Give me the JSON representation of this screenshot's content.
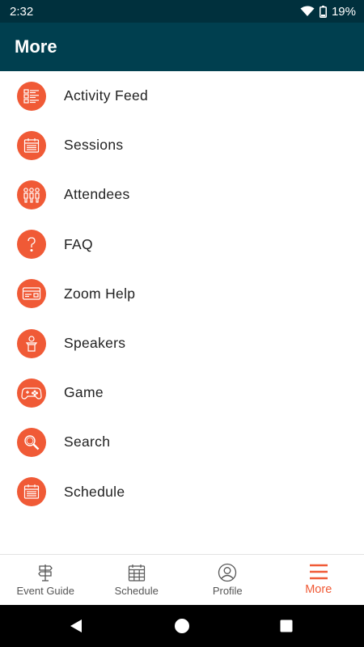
{
  "status_bar": {
    "time": "2:32",
    "battery": "19%",
    "icons": [
      "wifi-icon",
      "battery-icon"
    ]
  },
  "app_bar": {
    "title": "More"
  },
  "menu": {
    "items": [
      {
        "label": "Activity Feed",
        "icon": "activity-feed-icon"
      },
      {
        "label": "Sessions",
        "icon": "calendar-icon"
      },
      {
        "label": "Attendees",
        "icon": "people-icon"
      },
      {
        "label": "FAQ",
        "icon": "question-icon"
      },
      {
        "label": "Zoom Help",
        "icon": "card-icon"
      },
      {
        "label": "Speakers",
        "icon": "speaker-podium-icon"
      },
      {
        "label": "Game",
        "icon": "gamepad-icon"
      },
      {
        "label": "Search",
        "icon": "search-icon"
      },
      {
        "label": "Schedule",
        "icon": "calendar-icon"
      }
    ]
  },
  "bottom_nav": {
    "tabs": [
      {
        "label": "Event Guide",
        "icon": "signpost-icon",
        "active": false
      },
      {
        "label": "Schedule",
        "icon": "calendar-grid-icon",
        "active": false
      },
      {
        "label": "Profile",
        "icon": "profile-icon",
        "active": false
      },
      {
        "label": "More",
        "icon": "hamburger-menu-icon",
        "active": true
      }
    ]
  },
  "colors": {
    "status_bar": "#00303d",
    "app_bar": "#003f4f",
    "accent": "#f05a36",
    "inactive_tab": "#555555"
  }
}
